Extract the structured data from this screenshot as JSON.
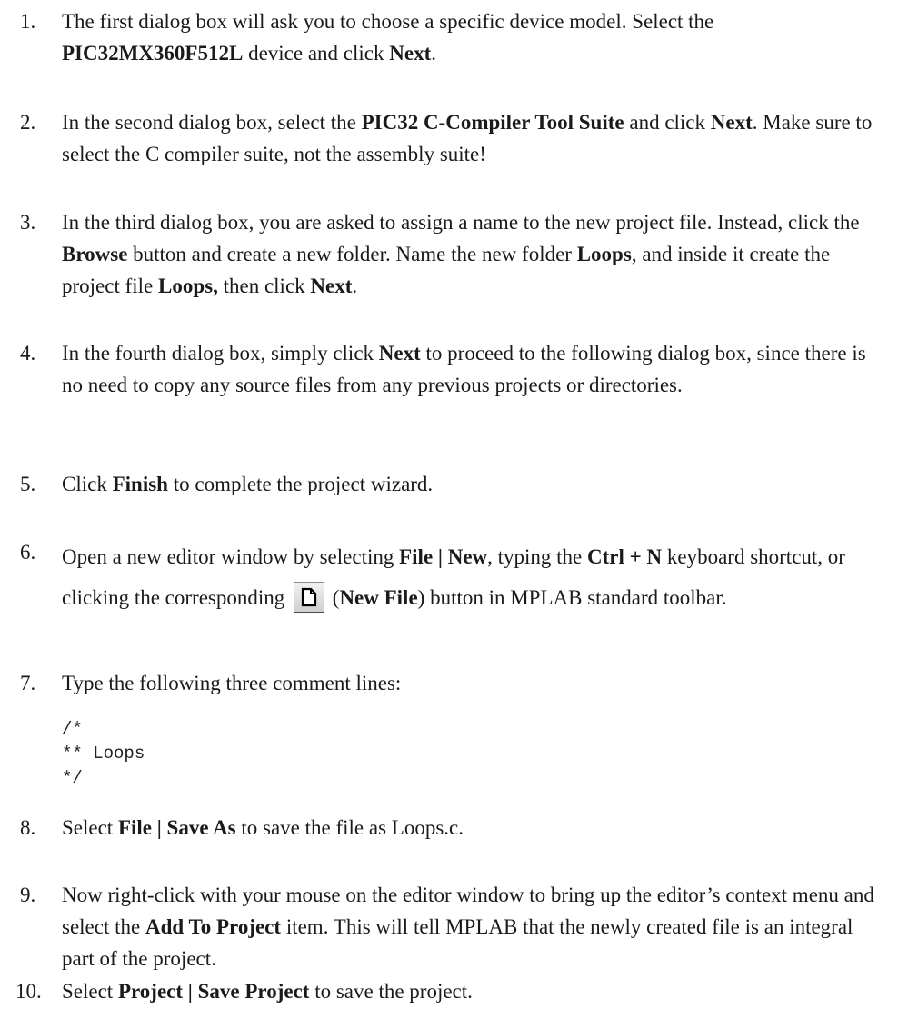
{
  "steps": [
    {
      "num": "1.",
      "parts": [
        {
          "t": "The first dialog box will ask you to choose a specific device model. Select the "
        },
        {
          "t": "PIC32MX360F512L",
          "b": true
        },
        {
          "t": " device and click "
        },
        {
          "t": "Next",
          "b": true
        },
        {
          "t": "."
        }
      ]
    },
    {
      "num": "2.",
      "parts": [
        {
          "t": "In the second dialog box, select the "
        },
        {
          "t": "PIC32 C-Compiler Tool Suite",
          "b": true
        },
        {
          "t": " and click "
        },
        {
          "t": "Next",
          "b": true
        },
        {
          "t": ". Make sure to select the C compiler suite, not the assembly suite!"
        }
      ]
    },
    {
      "num": "3.",
      "parts": [
        {
          "t": "In the third dialog box, you are asked to assign a name to the new project file. Instead, click the "
        },
        {
          "t": "Browse",
          "b": true
        },
        {
          "t": " button and create a new folder. Name the new folder "
        },
        {
          "t": "Loops",
          "b": true
        },
        {
          "t": ", and inside it create the project file "
        },
        {
          "t": "Loops,",
          "b": true
        },
        {
          "t": " then click "
        },
        {
          "t": "Next",
          "b": true
        },
        {
          "t": "."
        }
      ]
    },
    {
      "num": "4.",
      "parts": [
        {
          "t": "In the fourth dialog box, simply click "
        },
        {
          "t": "Next",
          "b": true
        },
        {
          "t": " to proceed to the following dialog box, since there is no need to copy any source files from any previous projects or directories."
        }
      ]
    },
    {
      "num": "5.",
      "parts": [
        {
          "t": "Click "
        },
        {
          "t": "Finish",
          "b": true
        },
        {
          "t": " to complete the project wizard."
        }
      ]
    },
    {
      "num": "6.",
      "parts": [
        {
          "t": "Open a new editor window by selecting "
        },
        {
          "t": "File | New",
          "b": true
        },
        {
          "t": ", typing the "
        },
        {
          "t": "Ctrl + N",
          "b": true
        },
        {
          "t": " keyboard shortcut, or clicking the corresponding "
        },
        {
          "icon": "new-file-icon"
        },
        {
          "t": " ("
        },
        {
          "t": "New File",
          "b": true
        },
        {
          "t": ") button in MPLAB standard toolbar."
        }
      ]
    },
    {
      "num": "7.",
      "parts": [
        {
          "t": "Type the following three comment lines:"
        }
      ]
    },
    {
      "num": "8.",
      "parts": [
        {
          "t": "Select "
        },
        {
          "t": "File | Save As",
          "b": true
        },
        {
          "t": " to save the file as Loops.c."
        }
      ]
    },
    {
      "num": "9.",
      "parts": [
        {
          "t": "Now right-click with your mouse on the editor window to bring up the editor’s context menu and select the "
        },
        {
          "t": "Add To Project",
          "b": true
        },
        {
          "t": " item. This will tell MPLAB that the newly created file is an integral part of the project."
        }
      ]
    },
    {
      "num": "10.",
      "parts": [
        {
          "t": "Select "
        },
        {
          "t": "Project | Save Project",
          "b": true
        },
        {
          "t": " to save the project."
        }
      ]
    }
  ],
  "code_block": "/*\n** Loops\n*/",
  "colors": {
    "text": "#1a1a1a",
    "button_face": "#e0e0e0"
  }
}
